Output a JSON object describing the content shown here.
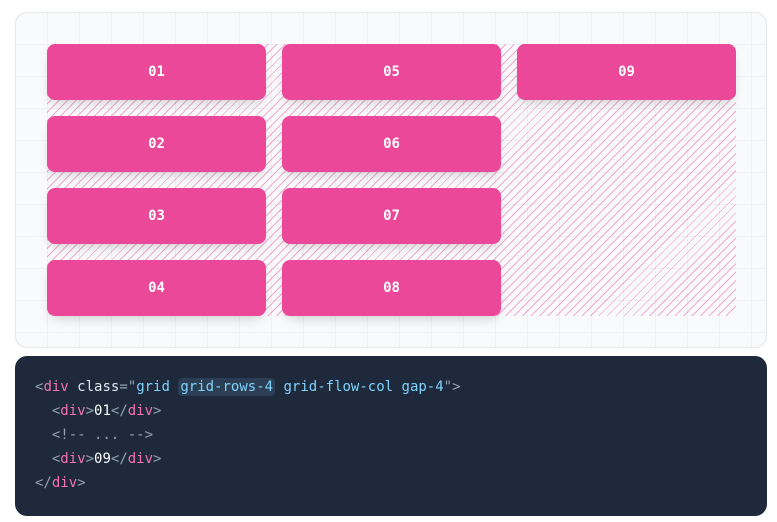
{
  "preview": {
    "items": [
      "01",
      "02",
      "03",
      "04",
      "05",
      "06",
      "07",
      "08",
      "09"
    ],
    "accent": "#ec4899"
  },
  "code": {
    "tag": "div",
    "attr": "class",
    "cls1": "grid",
    "cls_hl": "grid-rows-4",
    "cls2": "grid-flow-col",
    "cls3": "gap-4",
    "child1": "01",
    "comment": "<!-- ... -->",
    "child2": "09"
  }
}
